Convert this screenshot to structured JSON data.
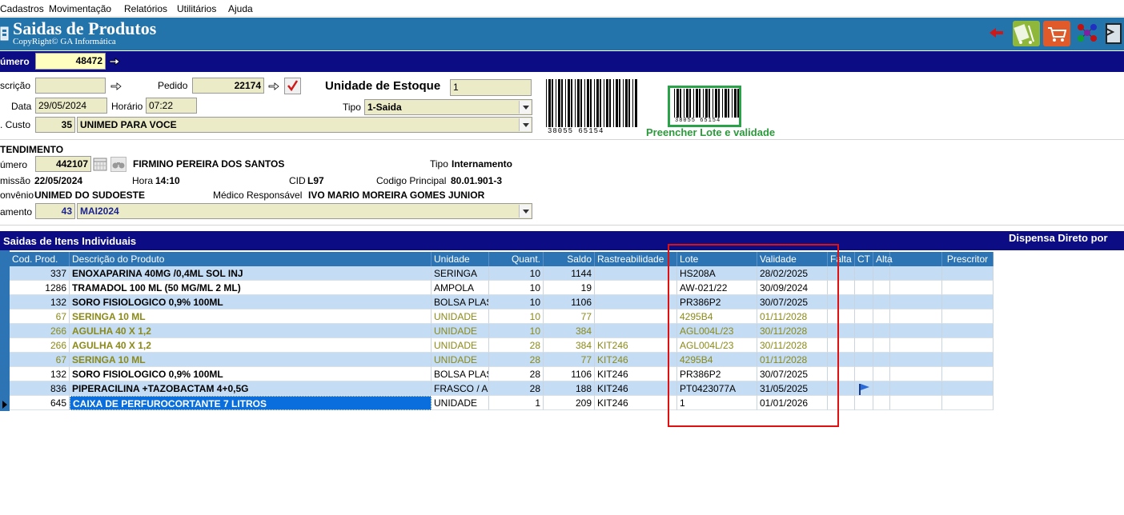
{
  "menu": [
    "Cadastros",
    "Movimentação",
    "Relatórios",
    "Utilitários",
    "Ajuda"
  ],
  "title": "Saidas de Produtos",
  "copyright": "CopyRight© GA Informática",
  "header": {
    "numero_label": "úmero",
    "numero_value": "48472"
  },
  "form": {
    "inscricao_label": "scrição",
    "inscricao_value": "",
    "pedido_label": "Pedido",
    "pedido_value": "22174",
    "unidade_estoque_label": "Unidade de Estoque",
    "unidade_estoque_value": "1",
    "data_label": "Data",
    "data_value": "29/05/2024",
    "horario_label": "Horário",
    "horario_value": "07:22",
    "tipo_label": "Tipo",
    "tipo_value": "1-Saida",
    "custo_label": ". Custo",
    "custo_code": "35",
    "custo_value": "UNIMED PARA VOCE",
    "barcode_number_1": "38055 65154",
    "barcode_number_2": "38055 65154",
    "lote_validade_hint": "Preencher Lote e validade"
  },
  "atendimento": {
    "section_label": "TENDIMENTO",
    "numero_label": "úmero",
    "numero_value": "442107",
    "patient_name": "FIRMINO PEREIRA DOS SANTOS",
    "tipo_label": "Tipo",
    "tipo_value": "Internamento",
    "admissao_label": "missão",
    "admissao_value": "22/05/2024",
    "hora_label": "Hora",
    "hora_value": "14:10",
    "cid_label": "CID",
    "cid_value": "L97",
    "codigo_label": "Codigo Principal",
    "codigo_value": "80.01.901-3",
    "convenio_label": "onvênio",
    "convenio_value": "UNIMED DO SUDOESTE",
    "medico_label": "Médico Responsável",
    "medico_value": "IVO MARIO MOREIRA GOMES JUNIOR",
    "faturamento_label": "amento",
    "faturamento_code": "43",
    "faturamento_value": "MAI2024"
  },
  "items_section": {
    "title": "Saidas de Itens Individuais",
    "right_title": "Dispensa Direto por"
  },
  "grid": {
    "columns": [
      "Cod. Prod.",
      "Descrição do Produto",
      "Unidade",
      "Quant.",
      "Saldo",
      "Rastreabilidade",
      "Lote",
      "Validade",
      "Falta",
      "CT",
      "Alta",
      "Prescritor"
    ],
    "rows": [
      {
        "cod": "337",
        "desc": "ENOXAPARINA 40MG /0,4ML SOL INJ",
        "unid": "SERINGA",
        "quant": "10",
        "saldo": "1144",
        "rast": "",
        "lote": "HS208A",
        "val": "28/02/2025",
        "style": "normal",
        "icon": ""
      },
      {
        "cod": "1286",
        "desc": "TRAMADOL 100 ML (50 MG/ML 2 ML)",
        "unid": "AMPOLA",
        "quant": "10",
        "saldo": "19",
        "rast": "",
        "lote": "AW-021/22",
        "val": "30/09/2024",
        "style": "normal",
        "icon": "ambulance"
      },
      {
        "cod": "132",
        "desc": "SORO FISIOLOGICO 0,9% 100ML",
        "unid": "BOLSA PLAS",
        "quant": "10",
        "saldo": "1106",
        "rast": "",
        "lote": "PR386P2",
        "val": "30/07/2025",
        "style": "normal",
        "icon": ""
      },
      {
        "cod": "67",
        "desc": "SERINGA 10 ML",
        "unid": "UNIDADE",
        "quant": "10",
        "saldo": "77",
        "rast": "",
        "lote": "4295B4",
        "val": "01/11/2028",
        "style": "olive",
        "icon": ""
      },
      {
        "cod": "266",
        "desc": "AGULHA 40 X 1,2",
        "unid": "UNIDADE",
        "quant": "10",
        "saldo": "384",
        "rast": "",
        "lote": "AGL004L/23",
        "val": "30/11/2028",
        "style": "olive",
        "icon": ""
      },
      {
        "cod": "266",
        "desc": "AGULHA 40 X 1,2",
        "unid": "UNIDADE",
        "quant": "28",
        "saldo": "384",
        "rast": "KIT246",
        "lote": "AGL004L/23",
        "val": "30/11/2028",
        "style": "olive",
        "icon": ""
      },
      {
        "cod": "67",
        "desc": "SERINGA 10 ML",
        "unid": "UNIDADE",
        "quant": "28",
        "saldo": "77",
        "rast": "KIT246",
        "lote": "4295B4",
        "val": "01/11/2028",
        "style": "olive",
        "icon": ""
      },
      {
        "cod": "132",
        "desc": "SORO FISIOLOGICO 0,9% 100ML",
        "unid": "BOLSA PLAS",
        "quant": "28",
        "saldo": "1106",
        "rast": "KIT246",
        "lote": "PR386P2",
        "val": "30/07/2025",
        "style": "normal",
        "icon": ""
      },
      {
        "cod": "836",
        "desc": "PIPERACILINA +TAZOBACTAM 4+0,5G",
        "unid": "FRASCO / AM",
        "quant": "28",
        "saldo": "188",
        "rast": "KIT246",
        "lote": "PT0423077A",
        "val": "31/05/2025",
        "style": "normal",
        "icon": "flag"
      },
      {
        "cod": "645",
        "desc": "CAIXA DE PERFUROCORTANTE 7 LITROS",
        "unid": "UNIDADE",
        "quant": "1",
        "saldo": "209",
        "rast": "KIT246",
        "lote": "1",
        "val": "01/01/2026",
        "style": "selected",
        "icon": ""
      }
    ]
  },
  "toolbar_icons": [
    "back-arrow-icon",
    "cart-hand-icon",
    "shopping-cart-icon",
    "network-icon",
    "scanner-icon"
  ]
}
